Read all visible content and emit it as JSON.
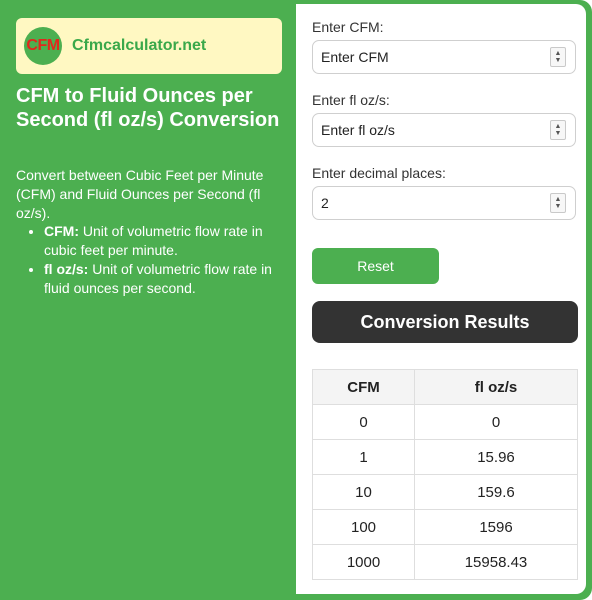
{
  "brand": {
    "logo_mark": "CFM",
    "site_name": "Cfmcalculator.net"
  },
  "page": {
    "title": "CFM to Fluid Ounces per Second (fl oz/s) Conversion",
    "intro": "Convert between Cubic Feet per Minute (CFM) and Fluid Ounces per Second (fl oz/s).",
    "definitions": [
      {
        "term": "CFM:",
        "text": " Unit of volumetric flow rate in cubic feet per minute."
      },
      {
        "term": "fl oz/s:",
        "text": " Unit of volumetric flow rate in fluid ounces per second."
      }
    ]
  },
  "form": {
    "cfm_label": "Enter CFM:",
    "cfm_placeholder": "Enter CFM",
    "floz_label": "Enter fl oz/s:",
    "floz_placeholder": "Enter fl oz/s",
    "decimals_label": "Enter decimal places:",
    "decimals_value": "2",
    "reset_label": "Reset"
  },
  "results": {
    "heading": "Conversion Results",
    "columns": [
      "CFM",
      "fl oz/s"
    ],
    "rows": [
      [
        "0",
        "0"
      ],
      [
        "1",
        "15.96"
      ],
      [
        "10",
        "159.6"
      ],
      [
        "100",
        "1596"
      ],
      [
        "1000",
        "15958.43"
      ]
    ]
  },
  "colors": {
    "accent": "#4caf50",
    "logo_bg": "#fff8c2",
    "logo_mark": "#e3261c",
    "dark_bar": "#333333"
  }
}
